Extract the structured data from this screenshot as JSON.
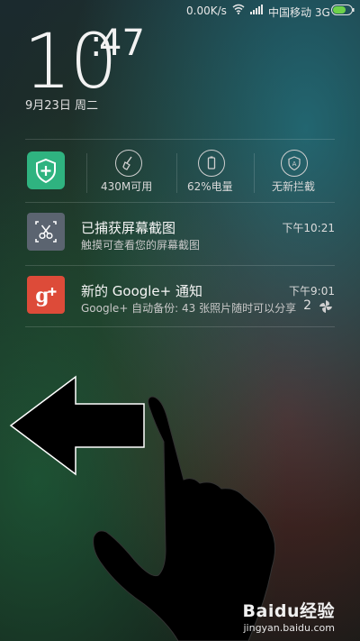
{
  "status_bar": {
    "speed": "0.00K/s",
    "carrier": "中国移动 3G",
    "icons": [
      "wifi-icon",
      "signal-icon",
      "battery-icon"
    ]
  },
  "clock": {
    "hour": "10",
    "minute": "47",
    "date": "9月23日 周二"
  },
  "toggles": [
    {
      "icon": "shield-plus-icon",
      "label": ""
    },
    {
      "icon": "broom-icon",
      "label": "430M可用"
    },
    {
      "icon": "battery-icon",
      "label": "62%电量"
    },
    {
      "icon": "shield-a-icon",
      "label": "无新拦截"
    }
  ],
  "notifications": [
    {
      "icon": "screenshot-scissors-icon",
      "title": "已捕获屏幕截图",
      "subtitle": "触摸可查看您的屏幕截图",
      "time": "下午10:21"
    },
    {
      "icon": "google-plus-icon",
      "title": "新的 Google+ 通知",
      "subtitle": "Google+ 自动备份: 43 张照片随时可以分享",
      "time": "下午9:01",
      "count": "2"
    }
  ],
  "watermark": {
    "brand": "Baidu经验",
    "url": "jingyan.baidu.com"
  },
  "colors": {
    "security_green": "#2fb380",
    "google_red": "#dd4b39",
    "screenshot_gray": "#5b6470"
  }
}
